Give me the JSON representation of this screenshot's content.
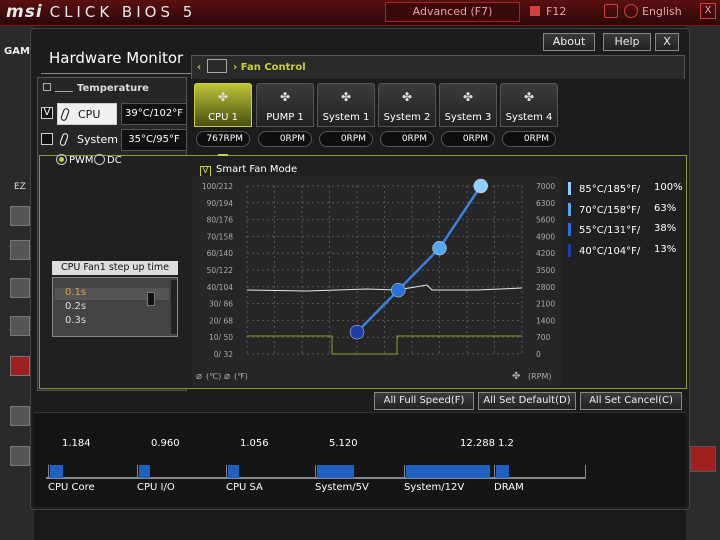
{
  "bios": {
    "logo_brand": "msi",
    "logo_text": "CLICK BIOS 5",
    "advanced_tab": "Advanced (F7)",
    "screenshot_key": "F12",
    "language": "English",
    "close_label": "X",
    "side_label": "GAM",
    "ez_label": "EZ"
  },
  "window": {
    "title": "Hardware Monitor",
    "about_label": "About",
    "help_label": "Help",
    "close_label": "X"
  },
  "temperature": {
    "header": "Temperature",
    "sensors": [
      {
        "name": "CPU",
        "checked": "V",
        "value": "39°C/102°F"
      },
      {
        "name": "System",
        "checked": "",
        "value": "35°C/95°F"
      }
    ]
  },
  "fan_control": {
    "label": "Fan Control",
    "fans": [
      {
        "name": "CPU 1",
        "rpm": "767RPM"
      },
      {
        "name": "PUMP 1",
        "rpm": "0RPM"
      },
      {
        "name": "System 1",
        "rpm": "0RPM"
      },
      {
        "name": "System 2",
        "rpm": "0RPM"
      },
      {
        "name": "System 3",
        "rpm": "0RPM"
      },
      {
        "name": "System 4",
        "rpm": "0RPM"
      }
    ],
    "mode_pwm": "PWM",
    "mode_dc": "DC",
    "step_title": "CPU Fan1 step up time",
    "step_options": [
      "0.1s",
      "0.2s",
      "0.3s"
    ],
    "smart_fan_label": "Smart Fan Mode",
    "smart_fan_checked": "V",
    "legend": [
      {
        "temp": "85°C/185°F/",
        "pct": "100%",
        "color": "#8fd0ff"
      },
      {
        "temp": "70°C/158°F/",
        "pct": "63%",
        "color": "#55a8f0"
      },
      {
        "temp": "55°C/131°F/",
        "pct": "38%",
        "color": "#2a70d8"
      },
      {
        "temp": "40°C/104°F/",
        "pct": "13%",
        "color": "#1a3fa8"
      }
    ],
    "unit_c": "(℃)",
    "unit_f": "(℉)",
    "unit_rpm": "(RPM)"
  },
  "chart_data": {
    "type": "line",
    "left_axis_ticks": [
      "100/212",
      "90/194",
      "80/176",
      "70/158",
      "60/140",
      "50/122",
      "40/104",
      "30/ 86",
      "20/ 68",
      "10/ 50",
      "0/ 32"
    ],
    "right_axis_ticks": [
      "7000",
      "6300",
      "5600",
      "4900",
      "4200",
      "3500",
      "2800",
      "2100",
      "1400",
      "700",
      "0"
    ],
    "curve_points": [
      {
        "temp_c": 40,
        "pct": 13
      },
      {
        "temp_c": 55,
        "pct": 38
      },
      {
        "temp_c": 70,
        "pct": 63
      },
      {
        "temp_c": 85,
        "pct": 100
      }
    ],
    "point_colors": [
      "#1a3fa8",
      "#2a70d8",
      "#55a8f0",
      "#8fd0ff"
    ],
    "xlim": [
      0,
      100
    ],
    "ylim": [
      0,
      100
    ]
  },
  "buttons": {
    "full_speed": "All Full Speed(F)",
    "set_default": "All Set Default(D)",
    "set_cancel": "All Set Cancel(C)"
  },
  "voltages": [
    {
      "label": "CPU Core",
      "value": "1.184",
      "fill": 0.15
    },
    {
      "label": "CPU I/O",
      "value": "0.960",
      "fill": 0.12
    },
    {
      "label": "CPU SA",
      "value": "1.056",
      "fill": 0.13
    },
    {
      "label": "System/5V",
      "value": "5.120",
      "fill": 0.42
    },
    {
      "label": "System/12V",
      "value": "12.288",
      "fill": 0.95
    },
    {
      "label": "DRAM",
      "value": "1.2",
      "fill": 0.15
    }
  ]
}
